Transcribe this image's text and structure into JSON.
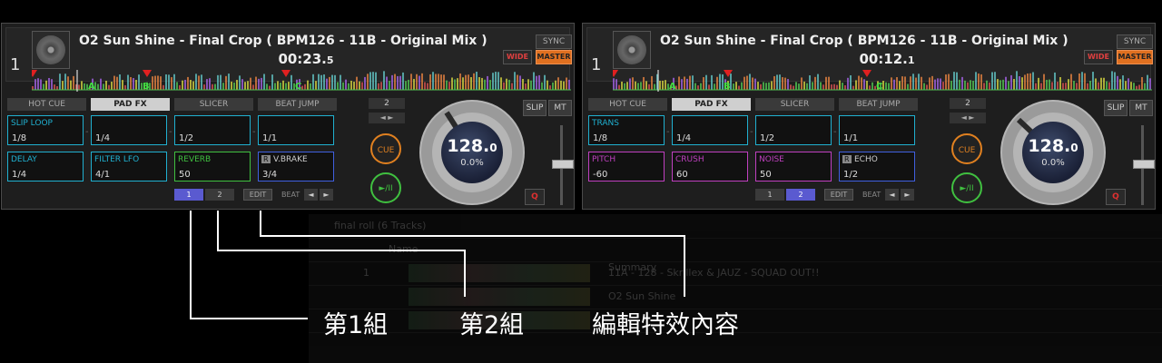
{
  "library": {
    "playlist_title": "final roll (6 Tracks)",
    "column_name": "Name",
    "row1_num": "1",
    "summary_label": "Summary",
    "track1": "11A - 128 - Skrillex & JAUZ - SQUAD OUT!!",
    "track2": "O2 Sun Shine"
  },
  "decks": [
    {
      "number": "1",
      "title": "O2 Sun Shine - Final Crop ( BPM126 - 11B - Original Mix )",
      "time_main": "00:23.",
      "time_frac": "5",
      "sync": "SYNC",
      "wide": "WIDE",
      "master": "MASTER",
      "hot_marks": [
        "A",
        "B",
        "C"
      ],
      "tabs": [
        "HOT CUE",
        "PAD FX",
        "SLICER",
        "BEAT JUMP"
      ],
      "active_tab": "PAD FX",
      "pads": [
        {
          "name": "SLIP LOOP",
          "value": "1/8",
          "color": "#20b0d0"
        },
        {
          "name": "",
          "value": "1/4",
          "color": "#20b0d0"
        },
        {
          "name": "",
          "value": "1/2",
          "color": "#20b0d0"
        },
        {
          "name": "",
          "value": "1/1",
          "color": "#20b0d0"
        },
        {
          "name": "DELAY",
          "value": "1/4",
          "color": "#20b0d0"
        },
        {
          "name": "FILTER LFO",
          "value": "4/1",
          "color": "#20b0d0"
        },
        {
          "name": "REVERB",
          "value": "50",
          "color": "#40c040"
        },
        {
          "name": "V.BRAKE",
          "value": "3/4",
          "color": "#4060e0",
          "badge": "R"
        }
      ],
      "bank1": "1",
      "bank2": "2",
      "active_bank": 1,
      "edit": "EDIT",
      "beat": "BEAT",
      "loop_num": "2",
      "cue": "CUE",
      "play": "►/II",
      "bpm_main": "128.",
      "bpm_frac": "0",
      "pitch": "0.0%",
      "slip": "SLIP",
      "mt": "MT",
      "quantize": "Q"
    },
    {
      "number": "1",
      "title": "O2 Sun Shine - Final Crop ( BPM126 - 11B - Original Mix )",
      "time_main": "00:12.",
      "time_frac": "1",
      "sync": "SYNC",
      "wide": "WIDE",
      "master": "MASTER",
      "hot_marks": [
        "A",
        "B",
        "C"
      ],
      "tabs": [
        "HOT CUE",
        "PAD FX",
        "SLICER",
        "BEAT JUMP"
      ],
      "active_tab": "PAD FX",
      "pads": [
        {
          "name": "TRANS",
          "value": "1/8",
          "color": "#20b0d0"
        },
        {
          "name": "",
          "value": "1/4",
          "color": "#20b0d0"
        },
        {
          "name": "",
          "value": "1/2",
          "color": "#20b0d0"
        },
        {
          "name": "",
          "value": "1/1",
          "color": "#20b0d0"
        },
        {
          "name": "PITCH",
          "value": "-60",
          "color": "#c040c0"
        },
        {
          "name": "CRUSH",
          "value": "60",
          "color": "#c040c0"
        },
        {
          "name": "NOISE",
          "value": "50",
          "color": "#c040c0"
        },
        {
          "name": "ECHO",
          "value": "1/2",
          "color": "#4060e0",
          "badge": "R"
        }
      ],
      "bank1": "1",
      "bank2": "2",
      "active_bank": 2,
      "edit": "EDIT",
      "beat": "BEAT",
      "loop_num": "2",
      "cue": "CUE",
      "play": "►/II",
      "bpm_main": "128.",
      "bpm_frac": "0",
      "pitch": "0.0%",
      "slip": "SLIP",
      "mt": "MT",
      "quantize": "Q"
    }
  ],
  "annotations": {
    "group1": "第1組",
    "group2": "第2組",
    "edit_fx": "編輯特效內容"
  },
  "colors": {
    "master": "#e07020",
    "bank_active": "#5a5ad0",
    "hot_cue": "#40e040",
    "cue_marker": "#e02020"
  }
}
